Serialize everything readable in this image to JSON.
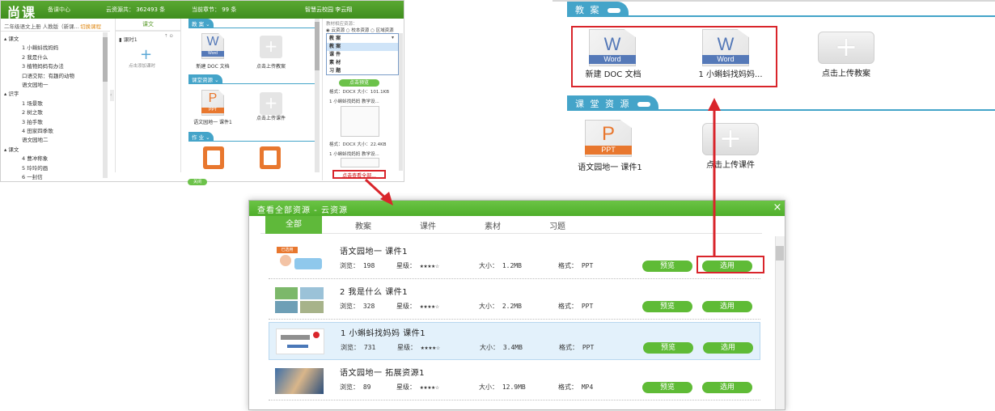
{
  "app": {
    "logo": "尚课",
    "logo_sub": "备课中心",
    "stat_resources": "云资源共： 362493 条",
    "stat_chapter": "当前章节： 99 条",
    "user": "智慧云校园 李云翔",
    "breadcrumb": "二年级语文上册 人教版（新课...",
    "breadcrumb_switch": "切换课程",
    "tree": [
      "▴ 课文",
      "1 小蝌蚪找妈妈",
      "2 我是什么",
      "3 植物妈妈有办法",
      "口语交际：有趣的动物",
      "语文园地一",
      "▴ 识字",
      "1 场景歌",
      "2 树之歌",
      "3 拍手歌",
      "4 田家四季歌",
      "语文园地二",
      "▴ 课文",
      "4 曹冲称象",
      "5 玲玲的画",
      "6 一封信"
    ],
    "col2_header": "课文",
    "lesson": "课时1",
    "click_lesson": "点击添加课时",
    "section_jiaoan": "教 案",
    "section_ketang": "课堂资源",
    "section_zuoye": "作 业",
    "word_letter": "W",
    "word_band": "Word",
    "ppt_letter": "P",
    "ppt_band": "PPT",
    "new_doc": "新建 DOC 文档",
    "upload_jiaoan": "点击上传教案",
    "ppt_caption": "语文园地一 课件1",
    "upload_kejian": "点击上传课件",
    "side_title": "教材相应资源：",
    "side_radio": "◉ 云资源 ○ 校本资源 ○ 区域资源",
    "dropdown_selected": "教 案",
    "dropdown_options": [
      "教 案",
      "课 件",
      "素 材",
      "习 题"
    ],
    "preview_btn": "点击预览",
    "side_meta1": "格式：DOCX 大小：101.1KB",
    "side_item1": "1 小蝌蚪找妈妈 教学设...",
    "side_meta2": "格式：DOCX 大小：22.4KB",
    "side_item2": "1 小蝌蚪找妈妈 教学设...",
    "view_all": "点击查看全部...",
    "bottom_btn": "关闭"
  },
  "zoom": {
    "tab_jiaoan": "教 案",
    "tab_ketang": "课 堂 资 源",
    "word_letter": "W",
    "word_band": "Word",
    "ppt_letter": "P",
    "ppt_band": "PPT",
    "doc1": "新建 DOC 文档",
    "doc2": "1 小蝌蚪找妈妈...",
    "upload_jiaoan": "点击上传教案",
    "ppt1": "语文园地一 课件1",
    "upload_kejian": "点击上传课件",
    "plus": "+"
  },
  "modal": {
    "title": "查看全部资源 - 云资源",
    "close": "×",
    "tabs": [
      "全部",
      "教案",
      "课件",
      "素材",
      "习题"
    ],
    "labels": {
      "views": "浏览：",
      "stars": "星级：",
      "size": "大小：",
      "format": "格式：",
      "preview": "预览",
      "use": "选用"
    },
    "rows": [
      {
        "title": "语文园地一 课件1",
        "views": "198",
        "stars": "★★★★☆",
        "size": "1.2MB",
        "format": "PPT",
        "badge": "已选用"
      },
      {
        "title": "2 我是什么 课件1",
        "views": "328",
        "stars": "★★★★☆",
        "size": "2.2MB",
        "format": "PPT"
      },
      {
        "title": "1 小蝌蚪找妈妈 课件1",
        "views": "731",
        "stars": "★★★★☆",
        "size": "3.4MB",
        "format": "PPT"
      },
      {
        "title": "语文园地一 拓展资源1",
        "views": "89",
        "stars": "★★★★☆",
        "size": "12.9MB",
        "format": "MP4"
      }
    ]
  },
  "colors": {
    "green": "#5fbb36",
    "blue": "#44a4c9",
    "red": "#d9252b",
    "word_blue": "#5579b8",
    "ppt_orange": "#e8772e"
  }
}
